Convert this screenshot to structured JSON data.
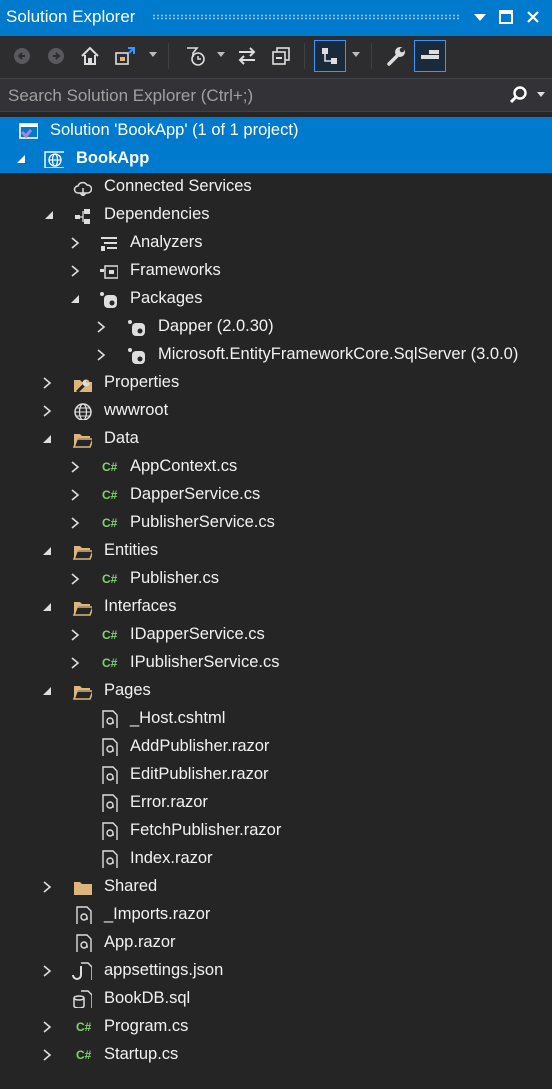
{
  "window": {
    "title": "Solution Explorer"
  },
  "search": {
    "placeholder": "Search Solution Explorer (Ctrl+;)"
  },
  "tree": {
    "solution": "Solution 'BookApp' (1 of 1 project)",
    "project": "BookApp",
    "connected_services": "Connected Services",
    "dependencies": "Dependencies",
    "analyzers": "Analyzers",
    "frameworks": "Frameworks",
    "packages": "Packages",
    "dapper": "Dapper (2.0.30)",
    "efcore": "Microsoft.EntityFrameworkCore.SqlServer (3.0.0)",
    "properties": "Properties",
    "wwwroot": "wwwroot",
    "data": "Data",
    "appcontext": "AppContext.cs",
    "dapperservice": "DapperService.cs",
    "publisherservice": "PublisherService.cs",
    "entities": "Entities",
    "publisher": "Publisher.cs",
    "interfaces": "Interfaces",
    "idapperservice": "IDapperService.cs",
    "ipublisherservice": "IPublisherService.cs",
    "pages": "Pages",
    "host": "_Host.cshtml",
    "addpublisher": "AddPublisher.razor",
    "editpublisher": "EditPublisher.razor",
    "error": "Error.razor",
    "fetchpublisher": "FetchPublisher.razor",
    "index": "Index.razor",
    "shared": "Shared",
    "imports": "_Imports.razor",
    "app": "App.razor",
    "appsettings": "appsettings.json",
    "bookdb": "BookDB.sql",
    "program": "Program.cs",
    "startup": "Startup.cs"
  },
  "icons": {
    "csharp": "C#",
    "folder_color": "#dcb67a",
    "cs_color": "#7fd36b",
    "accent": "#007acc"
  }
}
